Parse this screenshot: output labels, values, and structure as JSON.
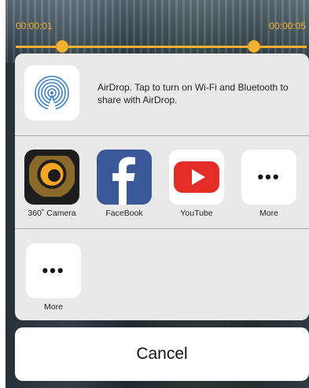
{
  "trimmer": {
    "start_time": "00:00:01",
    "end_time": "00:00:05"
  },
  "airdrop": {
    "icon": "airdrop-icon",
    "text": "AirDrop. Tap to turn on Wi-Fi and Bluetooth to share with AirDrop."
  },
  "apps": [
    {
      "label": "360˚ Camera",
      "icon": "camera-360-icon"
    },
    {
      "label": "FaceBook",
      "icon": "facebook-icon"
    },
    {
      "label": "YouTube",
      "icon": "youtube-icon"
    },
    {
      "label": "More",
      "icon": "more-icon"
    }
  ],
  "actions": [
    {
      "label": "More",
      "icon": "more-icon"
    }
  ],
  "cancel_label": "Cancel",
  "colors": {
    "accent": "#f2b134",
    "facebook": "#3b5998",
    "youtube": "#e52d27"
  }
}
